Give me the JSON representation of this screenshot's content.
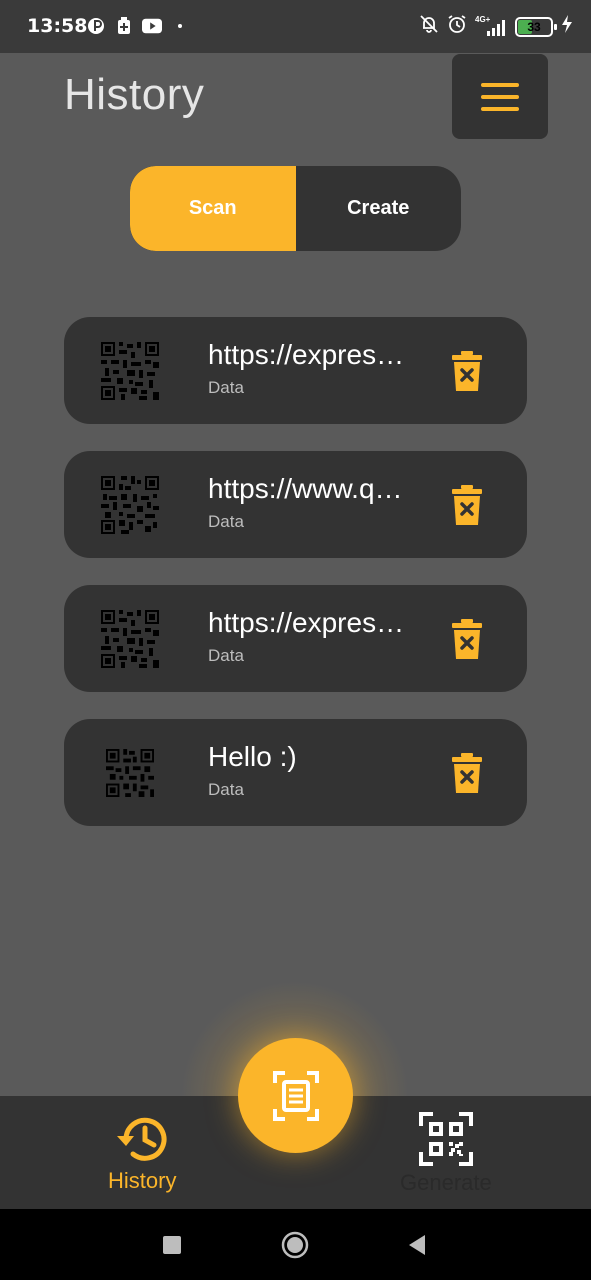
{
  "status_bar": {
    "time": "13:58",
    "network": "4G+",
    "battery": "33",
    "left_icons": [
      "app-icon",
      "battery-saver-icon",
      "youtube-icon",
      "dot-icon"
    ],
    "right_icons": [
      "bell-off-icon",
      "alarm-icon",
      "signal-icon",
      "battery-icon",
      "charging-icon"
    ]
  },
  "header": {
    "title": "History",
    "menu_icon": "hamburger-icon"
  },
  "tabs": {
    "scan_label": "Scan",
    "create_label": "Create",
    "active": "Scan"
  },
  "history_items": [
    {
      "title": "https://expres…",
      "subtitle": "Data"
    },
    {
      "title": "https://www.q…",
      "subtitle": "Data"
    },
    {
      "title": "https://expres…",
      "subtitle": "Data"
    },
    {
      "title": "Hello :)",
      "subtitle": "Data"
    }
  ],
  "bottom_nav": {
    "history_label": "History",
    "generate_label": "Generate",
    "fab_icon": "scan-document-icon"
  },
  "colors": {
    "accent": "#fbb52a",
    "background": "#5a5a5a",
    "card": "#333333"
  }
}
